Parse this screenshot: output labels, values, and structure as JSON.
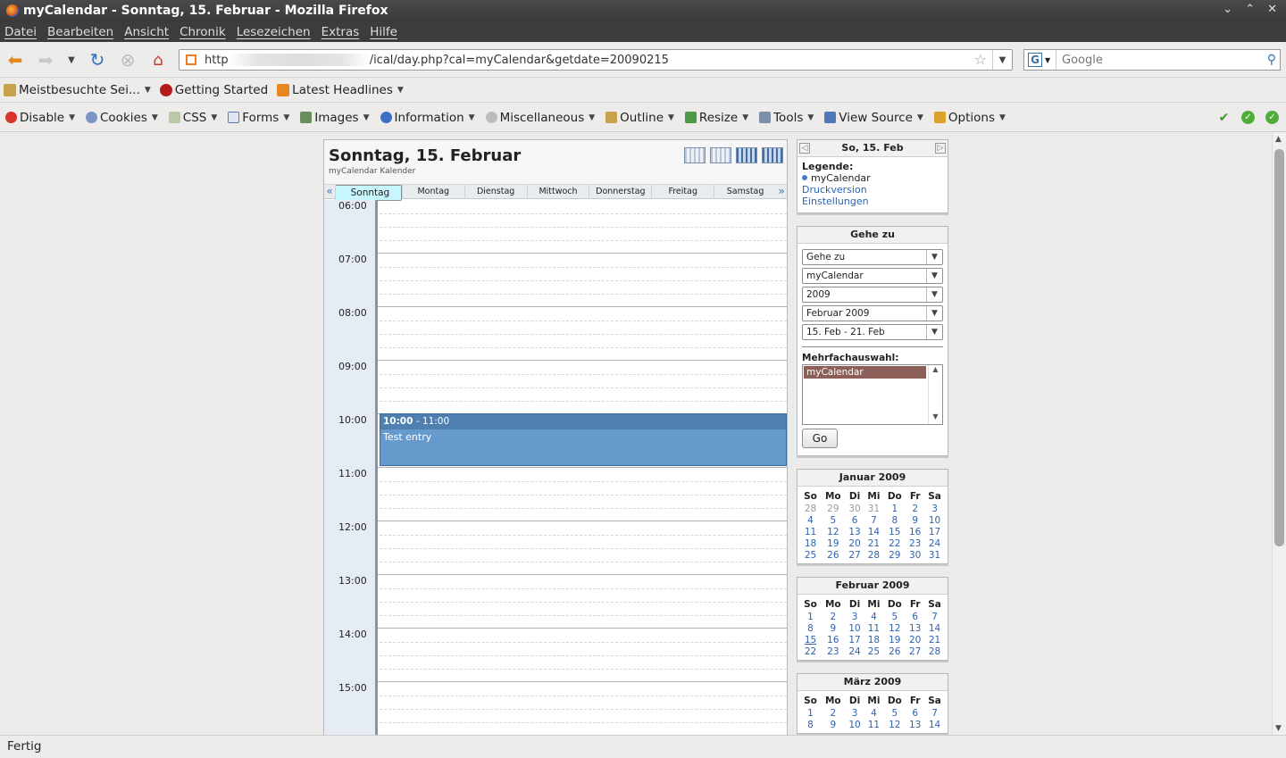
{
  "window": {
    "title": "myCalendar - Sonntag, 15. Februar - Mozilla Firefox",
    "controls": [
      "⌄",
      "⌃",
      "✕"
    ]
  },
  "menu": [
    "Datei",
    "Bearbeiten",
    "Ansicht",
    "Chronik",
    "Lesezeichen",
    "Extras",
    "Hilfe"
  ],
  "nav": {
    "url_prefix": "http",
    "url_suffix": "/ical/day.php?cal=myCalendar&getdate=20090215",
    "search_placeholder": "Google"
  },
  "bookmarks": [
    "Meistbesuchte Sei...",
    "Getting Started",
    "Latest Headlines"
  ],
  "webdev": [
    "Disable",
    "Cookies",
    "CSS",
    "Forms",
    "Images",
    "Information",
    "Miscellaneous",
    "Outline",
    "Resize",
    "Tools",
    "View Source",
    "Options"
  ],
  "colors": {
    "accent": "#3b73c6",
    "event": "#6699cc",
    "selected_day": "#c7f6ff",
    "multi_select": "#8b5e57"
  },
  "calendar": {
    "title": "Sonntag, 15. Februar",
    "subtitle": "myCalendar Kalender",
    "prev": "«",
    "next": "»",
    "days": [
      "Sonntag",
      "Montag",
      "Dienstag",
      "Mittwoch",
      "Donnerstag",
      "Freitag",
      "Samstag"
    ],
    "hours": [
      "06:00",
      "07:00",
      "08:00",
      "09:00",
      "10:00",
      "11:00",
      "12:00",
      "13:00",
      "14:00",
      "15:00"
    ],
    "event": {
      "start": "10:00",
      "end": "- 11:00",
      "title": "Test entry"
    }
  },
  "sidebar": {
    "date_header": "So, 15. Feb",
    "legend_title": "Legende:",
    "legend_item": "myCalendar",
    "print_link": "Druckversion",
    "settings_link": "Einstellungen",
    "goto_title": "Gehe zu",
    "selects": [
      "Gehe zu",
      "myCalendar",
      "2009",
      "Februar 2009",
      "15. Feb - 21. Feb"
    ],
    "multi_label": "Mehrfachauswahl:",
    "multi_item": "myCalendar",
    "go_button": "Go"
  },
  "minicals": [
    {
      "title": "Januar 2009",
      "weeks": [
        [
          "28",
          "29",
          "30",
          "31",
          "1",
          "2",
          "3"
        ],
        [
          "4",
          "5",
          "6",
          "7",
          "8",
          "9",
          "10"
        ],
        [
          "11",
          "12",
          "13",
          "14",
          "15",
          "16",
          "17"
        ],
        [
          "18",
          "19",
          "20",
          "21",
          "22",
          "23",
          "24"
        ],
        [
          "25",
          "26",
          "27",
          "28",
          "29",
          "30",
          "31"
        ]
      ],
      "other": [
        [
          0,
          0
        ],
        [
          0,
          1
        ],
        [
          0,
          2
        ],
        [
          0,
          3
        ]
      ]
    },
    {
      "title": "Februar 2009",
      "weeks": [
        [
          "1",
          "2",
          "3",
          "4",
          "5",
          "6",
          "7"
        ],
        [
          "8",
          "9",
          "10",
          "11",
          "12",
          "13",
          "14"
        ],
        [
          "15",
          "16",
          "17",
          "18",
          "19",
          "20",
          "21"
        ],
        [
          "22",
          "23",
          "24",
          "25",
          "26",
          "27",
          "28"
        ]
      ],
      "today": [
        2,
        0
      ]
    },
    {
      "title": "März 2009",
      "weeks": [
        [
          "1",
          "2",
          "3",
          "4",
          "5",
          "6",
          "7"
        ],
        [
          "8",
          "9",
          "10",
          "11",
          "12",
          "13",
          "14"
        ]
      ]
    }
  ],
  "weekday_abbr": [
    "So",
    "Mo",
    "Di",
    "Mi",
    "Do",
    "Fr",
    "Sa"
  ],
  "status": "Fertig"
}
